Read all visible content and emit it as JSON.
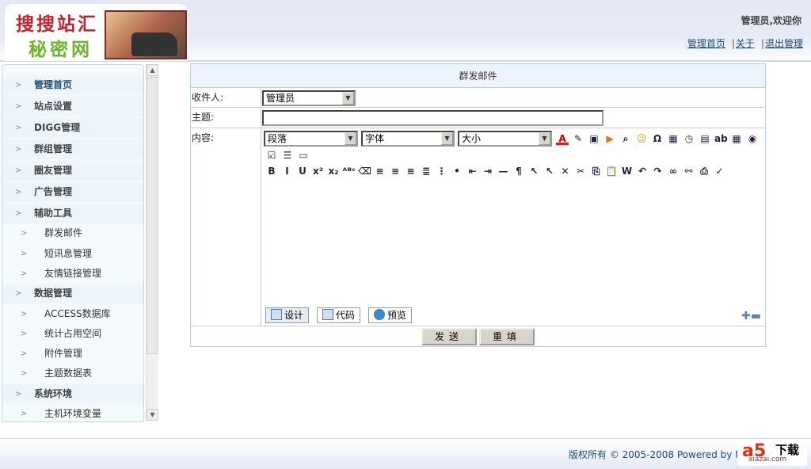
{
  "header": {
    "logo_line1": "搜搜站汇",
    "logo_line2": "秘密网",
    "welcome": "管理员,欢迎你",
    "links": [
      "管理首页",
      "关于",
      "退出管理"
    ]
  },
  "sidebar": {
    "items": [
      {
        "label": "管理首页",
        "level": "top",
        "active": true
      },
      {
        "label": "站点设置",
        "level": "top"
      },
      {
        "label": "DIGG管理",
        "level": "top"
      },
      {
        "label": "群组管理",
        "level": "top"
      },
      {
        "label": "圈友管理",
        "level": "top"
      },
      {
        "label": "广告管理",
        "level": "top"
      },
      {
        "label": "辅助工具",
        "level": "top"
      },
      {
        "label": "群发邮件",
        "level": "sub"
      },
      {
        "label": "短讯息管理",
        "level": "sub"
      },
      {
        "label": "友情链接管理",
        "level": "sub"
      },
      {
        "label": "数据管理",
        "level": "top"
      },
      {
        "label": "ACCESS数据库",
        "level": "sub"
      },
      {
        "label": "统计占用空间",
        "level": "sub"
      },
      {
        "label": "附件管理",
        "level": "sub"
      },
      {
        "label": "主题数据表",
        "level": "sub"
      },
      {
        "label": "系统环境",
        "level": "top"
      },
      {
        "label": "主机环境变量",
        "level": "sub"
      }
    ]
  },
  "form": {
    "title": "群发邮件",
    "recipient_label": "收件人:",
    "recipient_value": "管理员",
    "subject_label": "主题:",
    "subject_value": "",
    "content_label": "内容:",
    "editor": {
      "format": "段落",
      "font": "字体",
      "size": "大小",
      "toolbar_row1": [
        "font-color-icon",
        "highlight-icon",
        "image-icon",
        "media-icon",
        "find-icon",
        "smiley-icon",
        "special-char-icon",
        "date-icon",
        "time-icon",
        "template-icon",
        "textfield-icon",
        "table-icon",
        "radio-icon"
      ],
      "toolbar_row2": [
        "checkbox-icon",
        "select-list-icon",
        "button-icon"
      ],
      "toolbar_row3": [
        "bold-icon",
        "italic-icon",
        "underline-icon",
        "superscript-icon",
        "subscript-icon",
        "spellcheck-icon",
        "eraser-icon",
        "align-left-icon",
        "align-center-icon",
        "align-right-icon",
        "justify-icon",
        "ordered-list-icon",
        "unordered-list-icon",
        "outdent-icon",
        "indent-icon",
        "horizontal-rule-icon",
        "paragraph-icon",
        "select-plus-icon",
        "select-minus-icon",
        "delete-icon",
        "cut-icon",
        "copy-icon",
        "paste-icon",
        "paste-word-icon",
        "undo-icon",
        "redo-icon",
        "link-icon",
        "unlink-icon",
        "print-icon",
        "clean-icon"
      ],
      "modes": [
        "设计",
        "代码",
        "预览"
      ]
    },
    "send": "发送",
    "reset": "重填"
  },
  "footer": {
    "copyright": "版权所有 © 2005-2008 Powered by N",
    "badge_main": "a5",
    "badge_text": "下载",
    "badge_site": "xiazai.com"
  }
}
